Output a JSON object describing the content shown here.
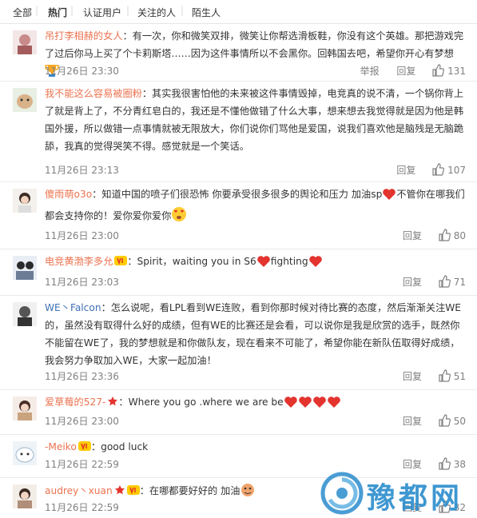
{
  "tabs": [
    "全部",
    "热门",
    "认证用户",
    "关注的人",
    "陌生人"
  ],
  "reply_label": "回复",
  "report_label": "举报",
  "watermark": "豫都网",
  "comments": [
    {
      "user": "吊打李相赫的女人",
      "text": "：有一次，你和微笑双排，微笑让你帮选滑板鞋，你没有这个英雄。那把游戏完了过后你马上买了个卡莉斯塔……因为这件事情所以不会黑你。回韩国去吧，希望你开心有梦想",
      "time": "11月26日 23:30",
      "likes": "131",
      "emoji": "trophy-icon"
    },
    {
      "user": "我不能这么容易被圈粉",
      "text": "：其实我很害怕他的未来被这件事情毁掉，电竞真的说不清，一个锅你背上了就是背上了，不分青红皂白的，我还是不懂他做错了什么大事，想来想去我觉得就是因为他是韩国外援，所以做错一点事情就被无限放大，你们说你们骂他是爱国，说我们喜欢他是脑残是无脑跪舔，我真的觉得哭笑不得。感觉就是一个笑话。",
      "time": "11月26日 23:13",
      "likes": "107"
    },
    {
      "user": "傻雨萌o3o",
      "text": "：知道中国的喷子们很恐怖 你要承受很多很多的舆论和压力 加油sp",
      "text2": "不管你在哪我们都会支持你的！爱你爱你爱你",
      "time": "11月26日 23:00",
      "likes": "80"
    },
    {
      "user": "电竞黄渤李多允",
      "text": "：Spirit，waiting you in S6",
      "text2": "fighting",
      "time": "11月26日 23:03",
      "likes": "71"
    },
    {
      "user": "WE丶Falcon",
      "text": "：怎么说呢，看LPL看到WE连败，看到你那时候对待比赛的态度，然后渐渐关注WE的，虽然没有取得什么好的成绩，但有WE的比赛还是会看，可以说你是我是欣赏的选手，既然你不能留在WE了，我的梦想就是和你做队友，现在看来不可能了，希望你能在新队伍取得好成绩，我会努力争取加入WE，大家一起加油！",
      "time": "11月26日 23:36",
      "likes": "51"
    },
    {
      "user": "爱草莓的527-",
      "text": "：Where you go .where we are be",
      "time": "11月26日 23:00",
      "likes": "50"
    },
    {
      "user": "-Meiko",
      "text": "：good luck",
      "time": "11月26日 22:59",
      "likes": "38"
    },
    {
      "user": "audrey丶xuan",
      "text": "：在哪都要好好的 加油",
      "time": "11月26日 22:59",
      "likes": "32"
    }
  ]
}
